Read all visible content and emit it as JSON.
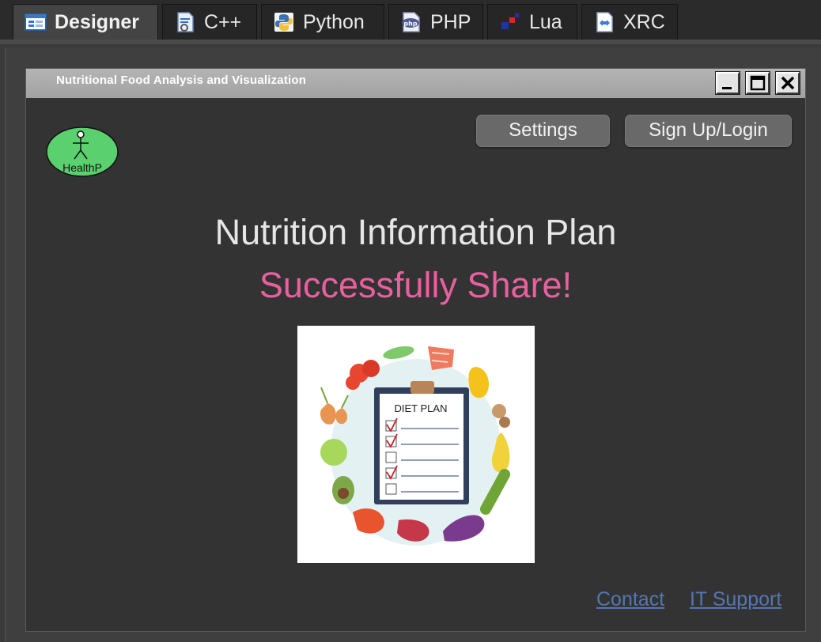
{
  "tabs": [
    {
      "label": "Designer",
      "icon": "designer-icon",
      "active": true
    },
    {
      "label": "C++",
      "icon": "cpp-file-icon"
    },
    {
      "label": "Python",
      "icon": "python-icon"
    },
    {
      "label": "PHP",
      "icon": "php-icon"
    },
    {
      "label": "Lua",
      "icon": "lua-icon"
    },
    {
      "label": "XRC",
      "icon": "xrc-icon"
    }
  ],
  "window": {
    "title": "Nutritional Food Analysis and Visualization",
    "controls": [
      "minimize-icon",
      "maximize-icon",
      "close-icon"
    ]
  },
  "logo": {
    "label": "HealthP",
    "icon": "stick-figure-icon",
    "color": "#5bd06e"
  },
  "header": {
    "settings_label": "Settings",
    "signup_label": "Sign Up/Login"
  },
  "main": {
    "heading": "Nutrition Information Plan",
    "status": "Successfully Share!",
    "status_color": "#e8609f",
    "image": {
      "clipboard_title": "DIET PLAN",
      "checklist": [
        true,
        true,
        false,
        true,
        false
      ]
    }
  },
  "footer": {
    "contact_label": "Contact",
    "support_label": "IT Support",
    "link_color": "#5277b2"
  }
}
